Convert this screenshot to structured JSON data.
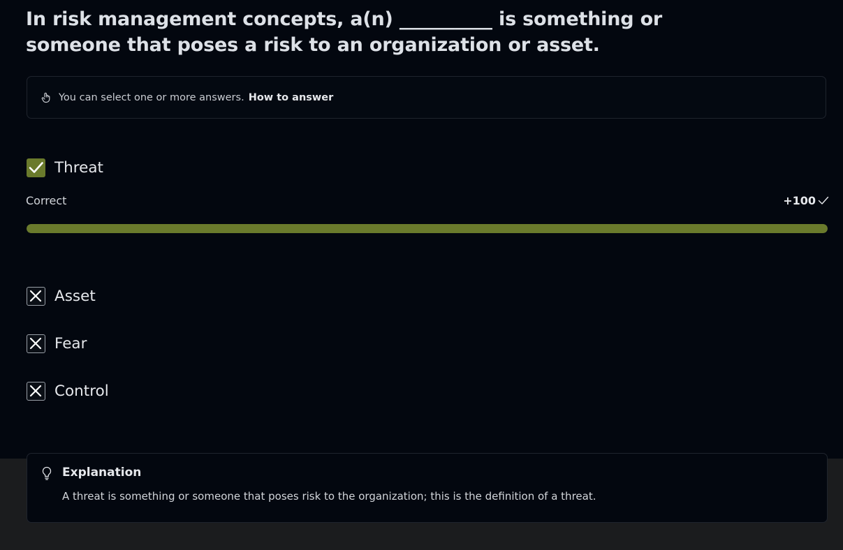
{
  "question": {
    "text": "In risk management concepts, a(n) __________ is something or someone that poses a risk to an organization or asset."
  },
  "hint": {
    "icon": "hand-pointer-icon",
    "text": "You can select one or more answers.",
    "link_label": "How to answer"
  },
  "answers": [
    {
      "label": "Threat",
      "state": "selected-correct",
      "icon": "check-icon"
    },
    {
      "label": "Asset",
      "state": "unselected-incorrect",
      "icon": "x-icon"
    },
    {
      "label": "Fear",
      "state": "unselected-incorrect",
      "icon": "x-icon"
    },
    {
      "label": "Control",
      "state": "unselected-incorrect",
      "icon": "x-icon"
    }
  ],
  "result": {
    "label": "Correct",
    "points": "+100",
    "progress_fraction": 1.0
  },
  "explanation": {
    "icon": "lightbulb-icon",
    "title": "Explanation",
    "body": "A threat is something or someone that poses risk to the organization; this is the definition of a threat."
  },
  "colors": {
    "correct_accent": "#6a7a2c",
    "background": "#03070f",
    "footer_background": "#1b1c1e"
  }
}
